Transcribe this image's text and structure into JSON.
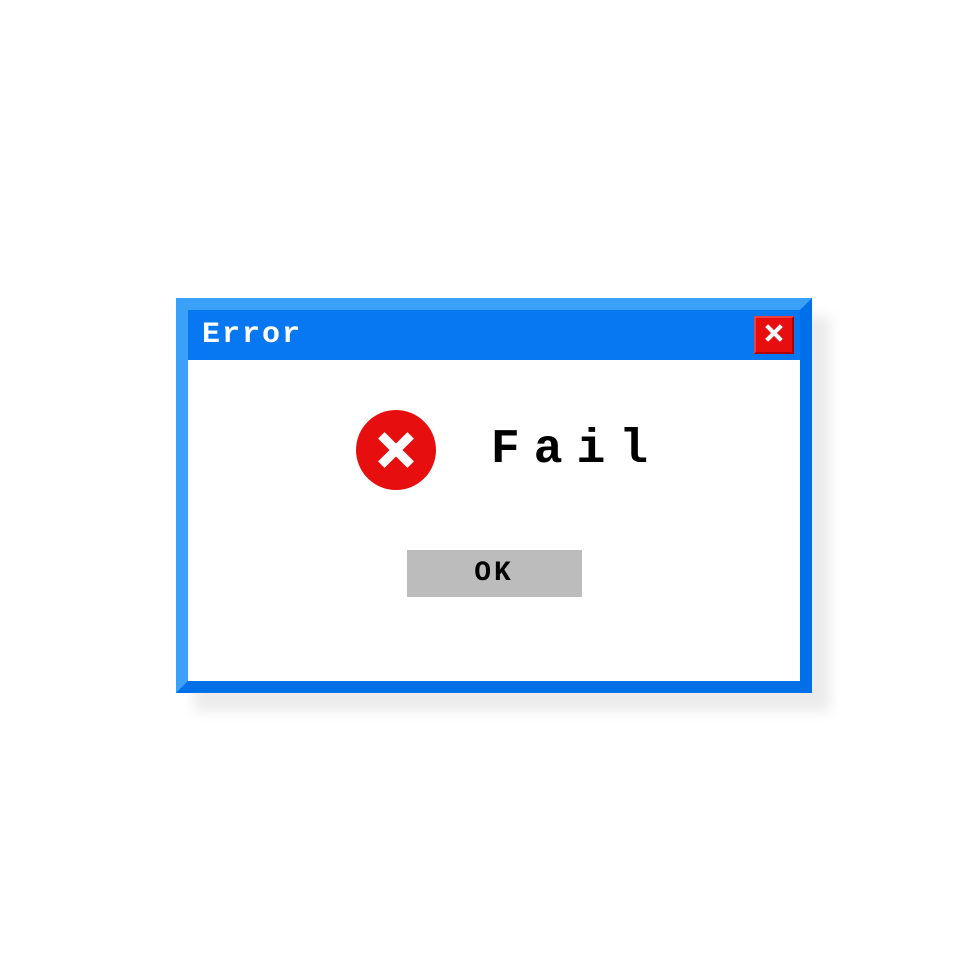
{
  "dialog": {
    "title": "Error",
    "message": "Fail",
    "ok_label": "OK"
  },
  "colors": {
    "accent": "#0878f2",
    "error": "#e70e0f",
    "button": "#bcbcbc"
  }
}
